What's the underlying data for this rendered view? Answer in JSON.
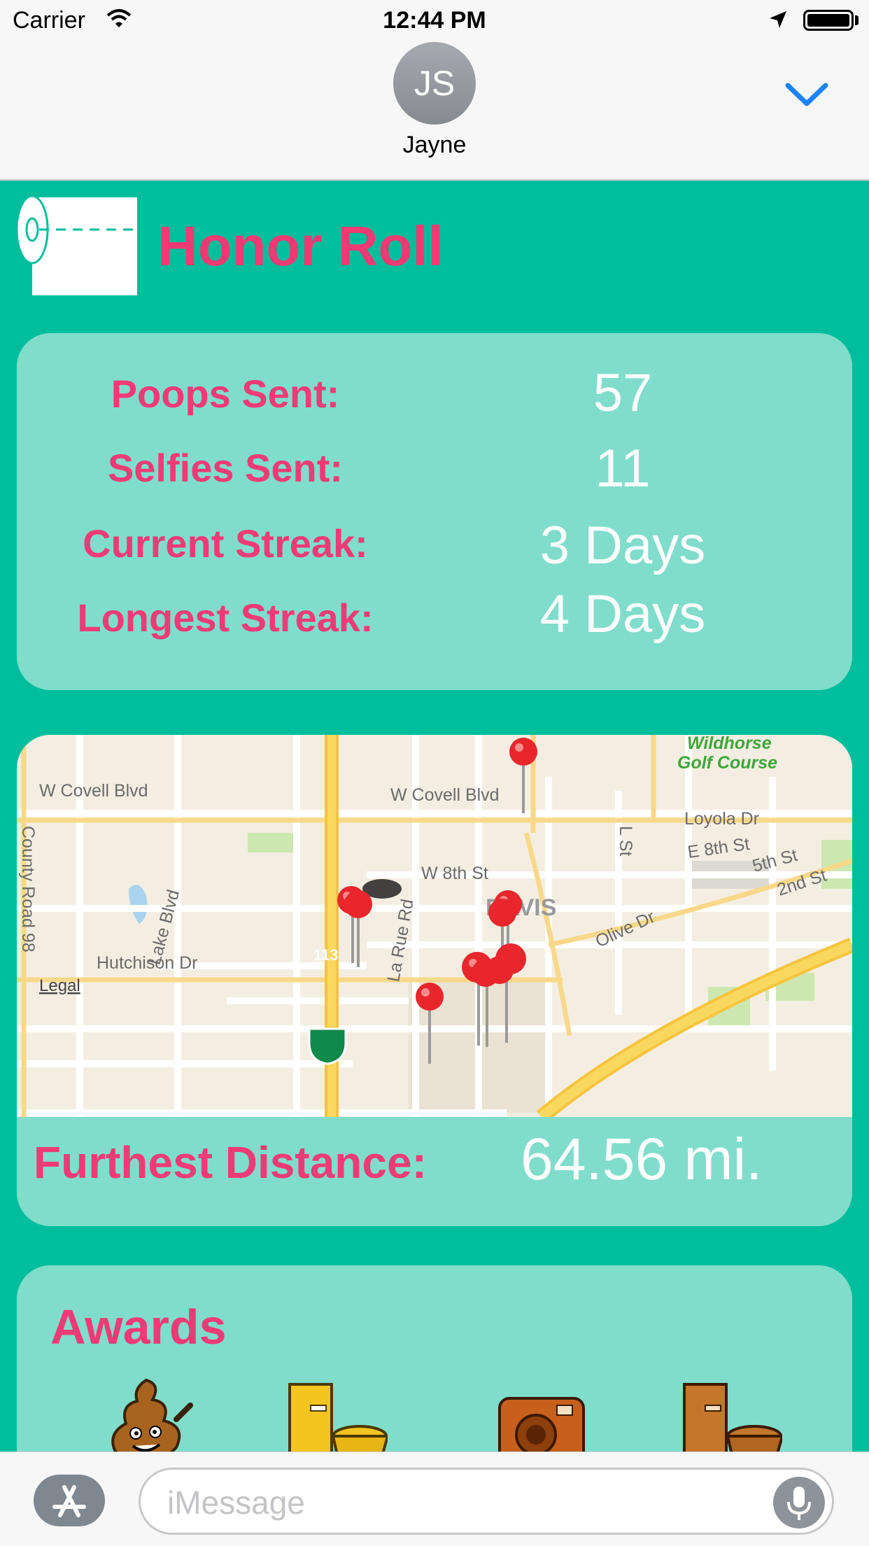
{
  "status_bar": {
    "carrier": "Carrier",
    "time": "12:44 PM"
  },
  "conversation": {
    "avatar_initials": "JS",
    "contact_name": "Jayne"
  },
  "honor_roll": {
    "title": "Honor Roll",
    "stats": [
      {
        "label": "Poops Sent:",
        "value": "57"
      },
      {
        "label": "Selfies Sent:",
        "value": "11"
      },
      {
        "label": "Current Streak:",
        "value": "3 Days"
      },
      {
        "label": "Longest Streak:",
        "value": "4 Days"
      }
    ]
  },
  "map": {
    "labels": {
      "wildhorse_1": "Wildhorse",
      "wildhorse_2": "Golf Course",
      "w_covell_left": "W Covell Blvd",
      "w_covell_mid": "W Covell Blvd",
      "county_road": "County Road 98",
      "lake_blvd": "Lake Blvd",
      "w_8th": "W 8th St",
      "l_st": "L St",
      "loyola": "Loyola Dr",
      "e_8th": "E 8th St",
      "fifth": "5th St",
      "second": "2nd St",
      "davis": "DAVIS",
      "olive": "Olive Dr",
      "hutchison": "Hutchison Dr",
      "la_rue": "La Rue Rd",
      "route": "113",
      "legal": "Legal"
    },
    "furthest_label": "Furthest Distance:",
    "furthest_value": "64.56 mi."
  },
  "awards": {
    "title": "Awards",
    "items": [
      "poop-award-icon",
      "gold-toilet-award-icon",
      "camera-award-icon",
      "bronze-toilet-award-icon"
    ]
  },
  "compose": {
    "placeholder": "iMessage"
  },
  "colors": {
    "background": "#00BE9C",
    "card": "#80DDCB",
    "accent_pink": "#EE3A76",
    "ios_blue": "#1A82FB"
  }
}
